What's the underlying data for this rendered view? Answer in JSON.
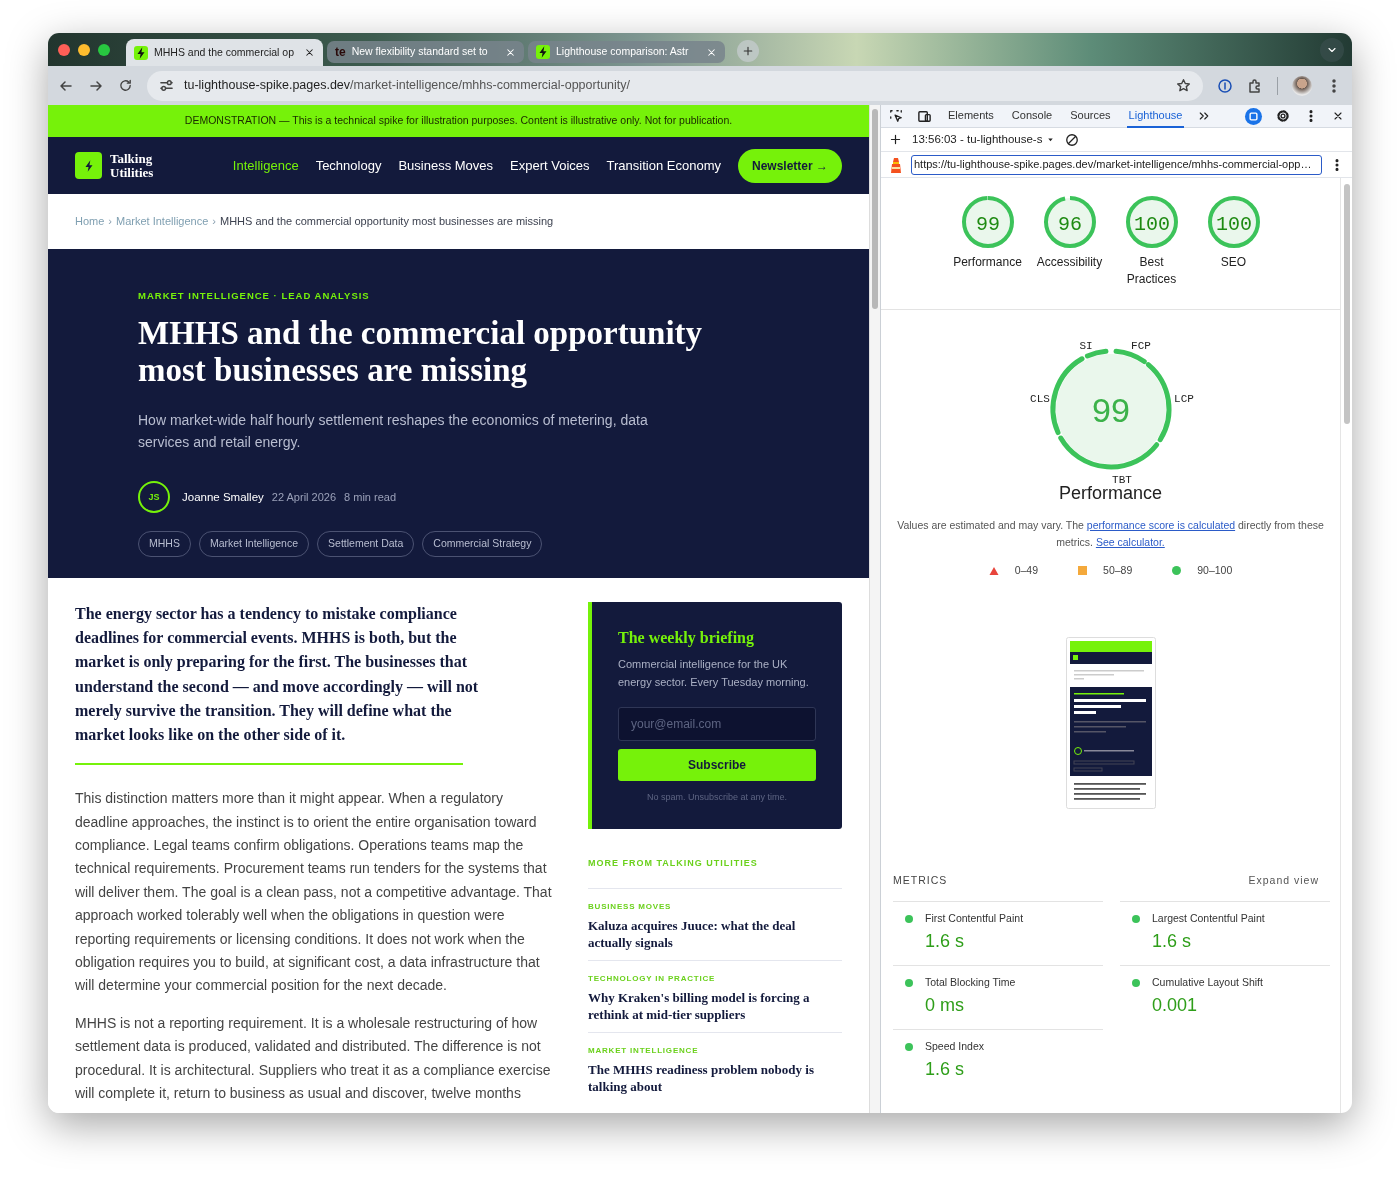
{
  "browser": {
    "tabs": [
      {
        "title": "MHHS and the commercial op",
        "favicon": {
          "kind": "bolt"
        },
        "selected": true
      },
      {
        "title": "New flexibility standard set to",
        "favicon": {
          "kind": "letters",
          "text": "te"
        },
        "selected": false
      },
      {
        "title": "Lighthouse comparison: Astr",
        "favicon": {
          "kind": "bolt"
        },
        "selected": false
      }
    ],
    "address": {
      "host": "tu-lighthouse-spike.pages.dev",
      "path": "/market-intelligence/mhhs-commercial-opportunity/"
    }
  },
  "site": {
    "banner": "DEMONSTRATION — This is a technical spike for illustration purposes. Content is illustrative only. Not for publication.",
    "logo": "Talking Utilities",
    "nav": [
      {
        "label": "Intelligence",
        "selected": true
      },
      {
        "label": "Technology",
        "selected": false
      },
      {
        "label": "Business Moves",
        "selected": false
      },
      {
        "label": "Expert Voices",
        "selected": false
      },
      {
        "label": "Transition Economy",
        "selected": false
      }
    ],
    "newsletter_button": "Newsletter →",
    "breadcrumb": {
      "separator": "›",
      "items": [
        {
          "label": "Home",
          "current": false
        },
        {
          "label": "Market Intelligence",
          "current": false
        },
        {
          "label": "MHHS and the commercial opportunity most businesses are missing",
          "current": true
        }
      ]
    },
    "hero": {
      "kicker": "MARKET INTELLIGENCE · LEAD ANALYSIS",
      "title": "MHHS and the commercial opportunity most businesses are missing",
      "subtitle": "How market-wide half hourly settlement reshapes the economics of metering, data services and retail energy.",
      "author": {
        "initials": "JS",
        "name": "Joanne Smalley"
      },
      "date": "22 April 2026",
      "read_time": "8 min read",
      "tags": [
        "MHHS",
        "Market Intelligence",
        "Settlement Data",
        "Commercial Strategy"
      ]
    },
    "article": {
      "lead": "The energy sector has a tendency to mistake compliance deadlines for commercial events. MHHS is both, but the market is only preparing for the first. The businesses that understand the second — and move accordingly — will not merely survive the transition. They will define what the market looks like on the other side of it.",
      "paragraphs": [
        "This distinction matters more than it might appear. When a regulatory deadline approaches, the instinct is to orient the entire organisation toward compliance. Legal teams confirm obligations. Operations teams map the technical requirements. Procurement teams run tenders for the systems that will deliver them. The goal is a clean pass, not a competitive advantage. That approach worked tolerably well when the obligations in question were reporting requirements or licensing conditions. It does not work when the obligation requires you to build, at significant cost, a data infrastructure that will determine your commercial position for the next decade.",
        "MHHS is not a reporting requirement. It is a wholesale restructuring of how settlement data is produced, validated and distributed. The difference is not procedural. It is architectural. Suppliers who treat it as a compliance exercise will complete it, return to business as usual and discover, twelve months"
      ]
    },
    "sidebar": {
      "briefing": {
        "title": "The weekly briefing",
        "text": "Commercial intelligence for the UK energy sector. Every Tuesday morning.",
        "placeholder": "your@email.com",
        "button": "Subscribe",
        "note": "No spam. Unsubscribe at any time."
      },
      "more_heading": "MORE FROM TALKING UTILITIES",
      "more": [
        {
          "category": "BUSINESS MOVES",
          "title": "Kaluza acquires Juuce: what the deal actually signals"
        },
        {
          "category": "TECHNOLOGY IN PRACTICE",
          "title": "Why Kraken's billing model is forcing a rethink at mid-tier suppliers"
        },
        {
          "category": "MARKET INTELLIGENCE",
          "title": "The MHHS readiness problem nobody is talking about"
        }
      ]
    }
  },
  "devtools": {
    "tabs": [
      {
        "label": "Elements",
        "selected": false
      },
      {
        "label": "Console",
        "selected": false
      },
      {
        "label": "Sources",
        "selected": false
      },
      {
        "label": "Lighthouse",
        "selected": true
      }
    ],
    "report": "13:56:03 - tu-lighthouse-s",
    "url": "https://tu-lighthouse-spike.pages.dev/market-intelligence/mhhs-commercial-opp…",
    "scores": [
      {
        "score": "99",
        "label": "Performance",
        "level": 0.99
      },
      {
        "score": "96",
        "label": "Accessibility",
        "level": 0.96
      },
      {
        "score": "100",
        "label": "Best Practices",
        "level": 1
      },
      {
        "score": "100",
        "label": "SEO",
        "level": 1
      }
    ],
    "performance": {
      "score": "99",
      "title": "Performance",
      "gauge_labels": [
        "SI",
        "FCP",
        "LCP",
        "TBT",
        "CLS"
      ],
      "note": [
        {
          "kind": "text",
          "text": "Values are estimated and may vary. The "
        },
        {
          "kind": "link",
          "text": "performance score is calculated"
        },
        {
          "kind": "text",
          "text": " directly from these metrics. "
        },
        {
          "kind": "link",
          "text": "See calculator."
        }
      ],
      "legend": [
        {
          "kind": "triangle",
          "range": "0–49",
          "color": "#e8453c"
        },
        {
          "kind": "square",
          "range": "50–89",
          "color": "#f4a93b"
        },
        {
          "kind": "circle",
          "range": "90–100",
          "color": "#3cc35a"
        }
      ]
    },
    "metrics_heading": "METRICS",
    "expand": "Expand view",
    "metrics": [
      {
        "name": "First Contentful Paint",
        "value": "1.6 s"
      },
      {
        "name": "Largest Contentful Paint",
        "value": "1.6 s"
      },
      {
        "name": "Total Blocking Time",
        "value": "0 ms"
      },
      {
        "name": "Cumulative Layout Shift",
        "value": "0.001"
      },
      {
        "name": "Speed Index",
        "value": "1.6 s"
      }
    ]
  }
}
